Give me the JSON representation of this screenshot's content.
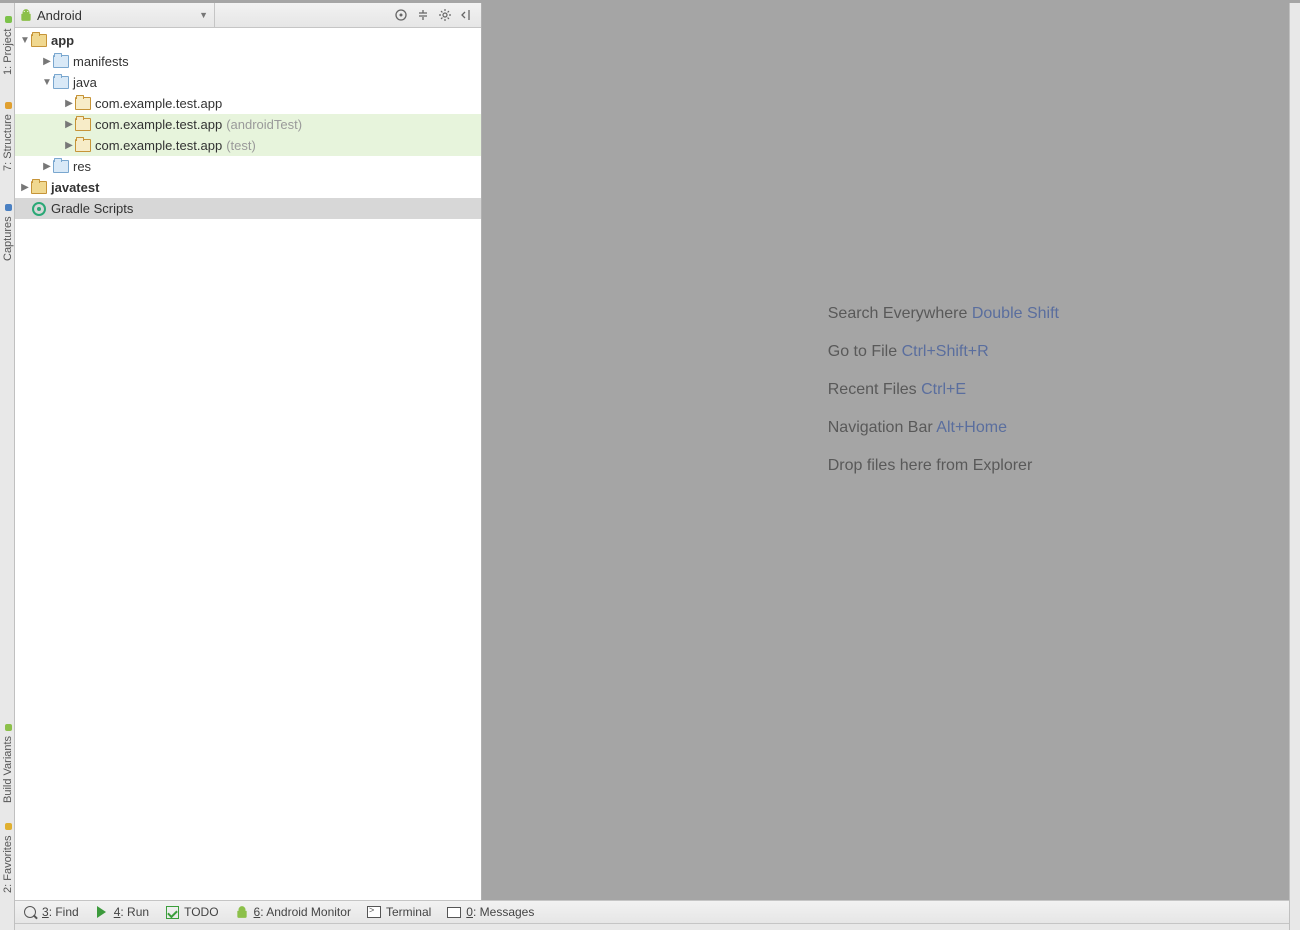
{
  "panel": {
    "view_label": "Android"
  },
  "left_tabs": {
    "project": "1: Project",
    "structure": "7: Structure",
    "captures": "Captures",
    "build_variants": "Build Variants",
    "favorites": "2: Favorites"
  },
  "tree": {
    "app": "app",
    "manifests": "manifests",
    "java": "java",
    "pkg_main": "com.example.test.app",
    "pkg_androidTest": "com.example.test.app",
    "pkg_androidTest_suffix": "(androidTest)",
    "pkg_test": "com.example.test.app",
    "pkg_test_suffix": "(test)",
    "res": "res",
    "javatest": "javatest",
    "gradle_scripts": "Gradle Scripts"
  },
  "hints": {
    "search_label": "Search Everywhere",
    "search_shortcut": "Double Shift",
    "goto_label": "Go to File",
    "goto_shortcut": "Ctrl+Shift+R",
    "recent_label": "Recent Files",
    "recent_shortcut": "Ctrl+E",
    "nav_label": "Navigation Bar",
    "nav_shortcut": "Alt+Home",
    "drop": "Drop files here from Explorer"
  },
  "bottom": {
    "find_u": "3",
    "find_rest": ": Find",
    "run_u": "4",
    "run_rest": ": Run",
    "todo": "TODO",
    "monitor_u": "6",
    "monitor_rest": ": Android Monitor",
    "terminal": "Terminal",
    "messages_u": "0",
    "messages_rest": ": Messages"
  }
}
